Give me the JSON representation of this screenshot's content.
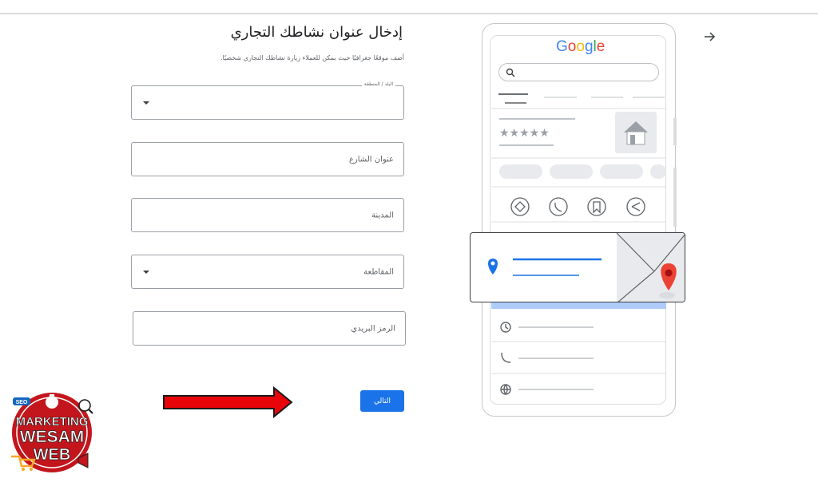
{
  "form": {
    "title": "إدخال عنوان نشاطك التجاري",
    "subtitle": "أضف موقعًا جغرافيًا حيث يمكن للعملاء زيارة نشاطك التجاري شخصيًا.",
    "fields": [
      {
        "label": "البلد / المنطقة",
        "type": "select",
        "floating": true
      },
      {
        "label": "عنوان الشارع",
        "type": "input"
      },
      {
        "label": "المدينة",
        "type": "input"
      },
      {
        "label": "المقاطعة",
        "type": "select"
      },
      {
        "label": "الرمز البريدي",
        "type": "input"
      }
    ],
    "next_label": "التالي"
  },
  "preview": {
    "brand": "Google",
    "rating_stars": "★★★★★",
    "icons": [
      "directions-icon",
      "phone-icon",
      "bookmark-icon",
      "share-icon",
      "location-pin-icon",
      "map-pin-icon",
      "clock-icon",
      "phone-icon",
      "globe-icon"
    ]
  },
  "watermark": {
    "line1": "MARKETING",
    "line2": "WESAM",
    "line3": "WEB",
    "badge": "SEO"
  },
  "colors": {
    "accent": "#1a73e8",
    "arrow": "#e8050a",
    "pin": "#ea4335"
  }
}
